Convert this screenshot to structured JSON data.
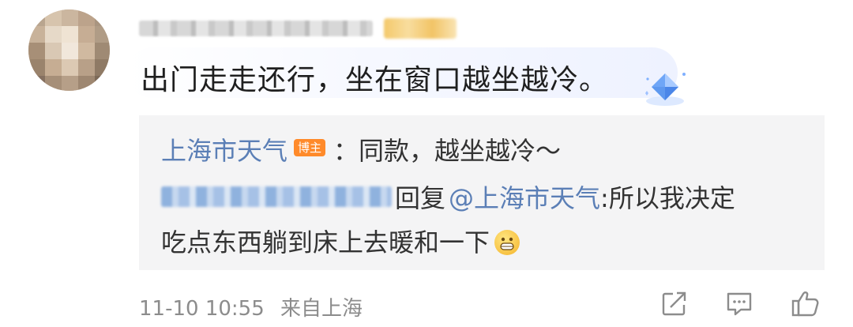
{
  "comment": {
    "text": "出门走走还行，坐在窗口越坐越冷。"
  },
  "reply": {
    "line1": {
      "author": "上海市天气",
      "author_tag": "博主",
      "text": "：同款，越坐越冷～"
    },
    "line2": {
      "action": "回复",
      "mention": "@上海市天气",
      "text_part1": ":所以我决定",
      "text_part2": "吃点东西躺到床上去暖和一下"
    }
  },
  "footer": {
    "timestamp": "11-10 10:55",
    "location": "来自上海"
  },
  "actions": [
    "share-icon",
    "comment-icon",
    "like-icon"
  ],
  "colors": {
    "link": "#5b7fb6",
    "author_tag_bg": "#ff8a2a",
    "meta_text": "#8c8c8c",
    "reply_bg": "#f4f4f5"
  }
}
